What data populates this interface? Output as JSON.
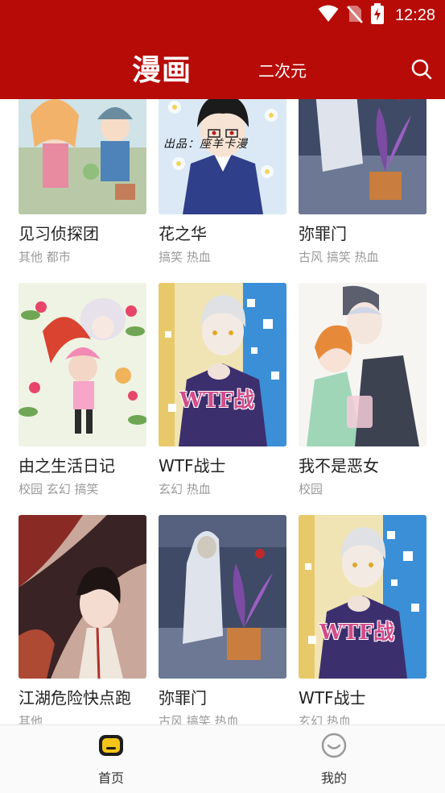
{
  "status": {
    "time": "12:28"
  },
  "header": {
    "title": "漫画",
    "secondary_tab": "二次元"
  },
  "comics": [
    {
      "title": "见习侦探团",
      "tags": "其他 都市"
    },
    {
      "title": "花之华",
      "tags": "搞笑 热血",
      "cover_text": "出品：座羊卡漫"
    },
    {
      "title": "弥罪门",
      "tags": "古风 搞笑 热血"
    },
    {
      "title": "由之生活日记",
      "tags": "校园 玄幻 搞笑"
    },
    {
      "title": "WTF战士",
      "tags": "玄幻 热血",
      "cover_text": "WTF战"
    },
    {
      "title": "我不是恶女",
      "tags": "校园"
    },
    {
      "title": "江湖危险快点跑",
      "tags": "其他"
    },
    {
      "title": "弥罪门",
      "tags": "古风 搞笑 热血"
    },
    {
      "title": "WTF战士",
      "tags": "玄幻 热血",
      "cover_text": "WTF战"
    }
  ],
  "bottom_nav": {
    "home": "首页",
    "mine": "我的"
  },
  "colors": {
    "brand": "#b70b07",
    "accent": "#f5c518"
  },
  "icons": [
    "wifi-icon",
    "no-sim-icon",
    "battery-charging-icon",
    "search-icon",
    "home-icon",
    "profile-icon"
  ]
}
